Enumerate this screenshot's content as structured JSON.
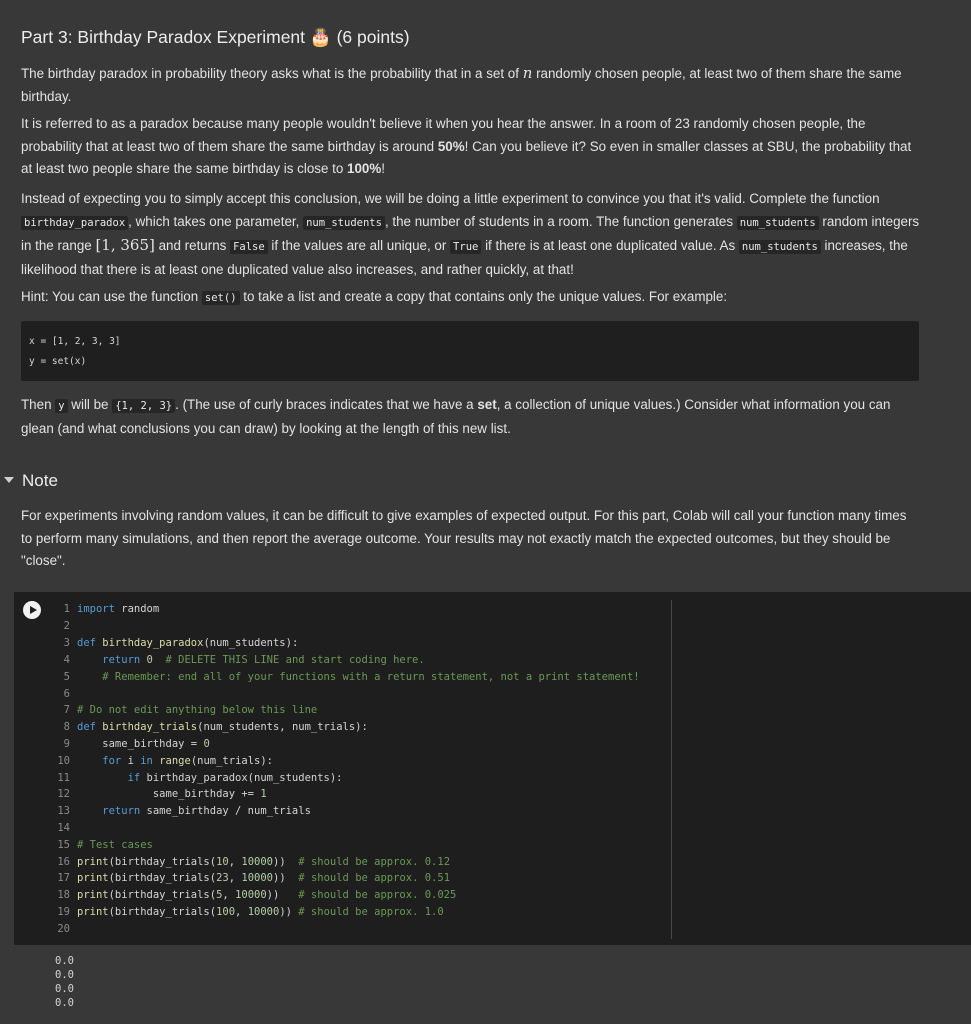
{
  "heading": {
    "title": "Part 3: Birthday Paradox Experiment",
    "emoji": "🎂",
    "points": "(6 points)"
  },
  "p1": {
    "a": "The birthday paradox in probability theory asks what is the probability that in a set of ",
    "var": "n",
    "b": " randomly chosen people, at least two of them share the same birthday."
  },
  "p2": {
    "a": "It is referred to as a paradox because many people wouldn't believe it when you hear the answer. In a room of 23 randomly chosen people, the probability that at least two of them share the same birthday is around ",
    "b1": "50%",
    "b": "! Can you believe it? So even in smaller classes at SBU, the probability that at least two people share the same birthday is close to ",
    "b2": "100%",
    "c": "!"
  },
  "p3": {
    "a": "Instead of expecting you to simply accept this conclusion, we will be doing a little experiment to convince you that it's valid. Complete the function ",
    "code1": "birthday_paradox",
    "b": ", which takes one parameter, ",
    "code2": "num_students",
    "c": ", the number of students in a room. The function generates ",
    "code3": "num_students",
    "d": " random integers in the range ",
    "range": "[1, 365]",
    "e": " and returns ",
    "code4": "False",
    "f": " if the values are all unique, or ",
    "code5": "True",
    "g": " if there is at least one duplicated value. As ",
    "code6": "num_students",
    "h": " increases, the likelihood that there is at least one duplicated value also increases, and rather quickly, at that!"
  },
  "p4": {
    "a": "Hint: You can use the function ",
    "code": "set()",
    "b": " to take a list and create a copy that contains only the unique values. For example:"
  },
  "example_code": {
    "line1": "x = [1, 2, 3, 3]",
    "line2": "y = set(x)"
  },
  "p5": {
    "a": "Then ",
    "code1": "y",
    "b": " will be ",
    "code2": "{1, 2, 3}",
    "c": ". (The use of curly braces indicates that we have a ",
    "bold": "set",
    "d": ", a collection of unique values.) Consider what information you can glean (and what conclusions you can draw) by looking at the length of this new list."
  },
  "note": {
    "title": "Note",
    "text": "For experiments involving random values, it can be difficult to give examples of expected output. For this part, Colab will call your function many times to perform many simulations, and then report the average outcome. Your results may not exactly match the expected outcomes, but they should be \"close\"."
  },
  "code_cell": {
    "line_numbers": [
      "1",
      "2",
      "3",
      "4",
      "5",
      "6",
      "7",
      "8",
      "9",
      "10",
      "11",
      "12",
      "13",
      "14",
      "15",
      "16",
      "17",
      "18",
      "19",
      "20"
    ],
    "l1": {
      "kw": "import",
      "rest": " random"
    },
    "l3": {
      "kw": "def",
      "name": " birthday_paradox",
      "rest": "(num_students):"
    },
    "l4": {
      "kw": "    return",
      "num": " 0",
      "cm": "  # DELETE THIS LINE and start coding here."
    },
    "l5": {
      "cm": "    # Remember: end all of your functions with a return statement, not a print statement!"
    },
    "l7": {
      "cm": "# Do not edit anything below this line"
    },
    "l8": {
      "kw": "def",
      "name": " birthday_trials",
      "rest": "(num_students, num_trials):"
    },
    "l9": {
      "rest": "    same_birthday = ",
      "num": "0"
    },
    "l10": {
      "kw": "    for",
      "a": " i ",
      "kw2": "in",
      "b": " ",
      "fn": "range",
      "c": "(num_trials):"
    },
    "l11": {
      "kw": "        if",
      "rest": " birthday_paradox(num_students):"
    },
    "l12": {
      "rest": "            same_birthday += ",
      "num": "1"
    },
    "l13": {
      "kw": "    return",
      "rest": " same_birthday / num_trials"
    },
    "l15": {
      "cm": "# Test cases"
    },
    "l16": {
      "fn": "print",
      "a": "(birthday_trials(",
      "n1": "10",
      "b": ", ",
      "n2": "10000",
      "c": "))  ",
      "cm": "# should be approx. 0.12"
    },
    "l17": {
      "fn": "print",
      "a": "(birthday_trials(",
      "n1": "23",
      "b": ", ",
      "n2": "10000",
      "c": "))  ",
      "cm": "# should be approx. 0.51"
    },
    "l18": {
      "fn": "print",
      "a": "(birthday_trials(",
      "n1": "5",
      "b": ", ",
      "n2": "10000",
      "c": "))   ",
      "cm": "# should be approx. 0.025"
    },
    "l19": {
      "fn": "print",
      "a": "(birthday_trials(",
      "n1": "100",
      "b": ", ",
      "n2": "10000",
      "c": ")) ",
      "cm": "# should be approx. 1.0"
    }
  },
  "output": [
    "0.0",
    "0.0",
    "0.0",
    "0.0"
  ],
  "colors": {
    "background": "#383838",
    "code_bg": "#1e1e1e",
    "keyword": "#569cd6",
    "comment": "#6a9955"
  }
}
